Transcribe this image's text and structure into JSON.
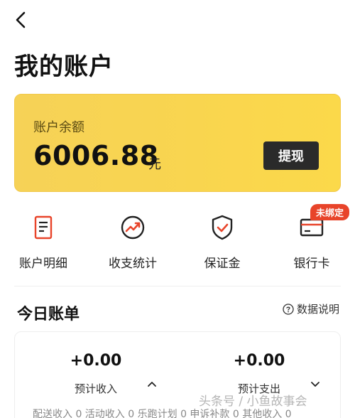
{
  "header": {
    "title": "我的账户"
  },
  "balance": {
    "label": "账户余额",
    "amount": "6006.88",
    "unit": "元",
    "withdraw_label": "提现"
  },
  "quick": {
    "items": [
      {
        "label": "账户明细",
        "icon": "document-icon"
      },
      {
        "label": "收支统计",
        "icon": "trend-icon"
      },
      {
        "label": "保证金",
        "icon": "shield-icon"
      },
      {
        "label": "银行卡",
        "icon": "bank-card-icon",
        "badge": "未绑定"
      }
    ]
  },
  "bill": {
    "title": "今日账单",
    "help_label": "数据说明",
    "income": {
      "value": "+0.00",
      "label": "预计收入"
    },
    "expense": {
      "value": "+0.00",
      "label": "预计支出"
    },
    "breakdown": "配送收入 0  活动收入 0  乐跑计划 0  申诉补款 0  其他收入 0"
  },
  "watermark": "头条号 / 小鱼故事会",
  "colors": {
    "card_yellow": "#f9d54f",
    "badge_red": "#e8442a",
    "button_dark": "#2a2a2a"
  }
}
